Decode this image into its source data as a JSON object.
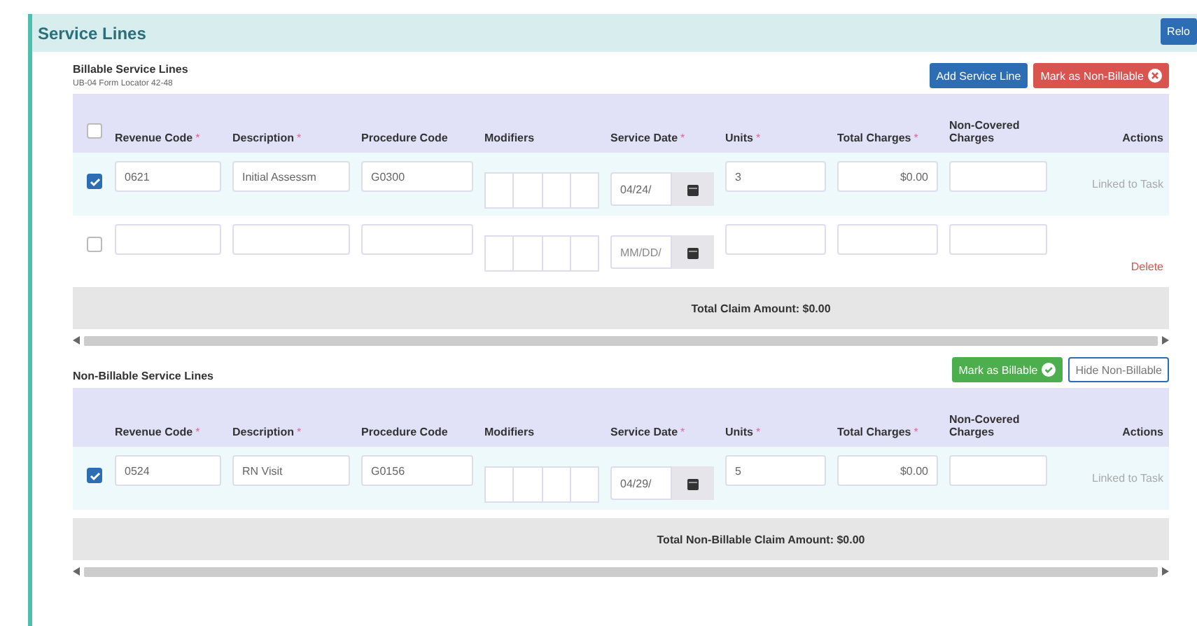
{
  "section": {
    "title": "Service Lines",
    "header_button": "Relo"
  },
  "billable": {
    "title": "Billable Service Lines",
    "subtitle": "UB-04 Form Locator 42-48",
    "buttons": [
      {
        "label": "Add Service Line",
        "kind": "primary"
      },
      {
        "label": "Mark as Non-Billable",
        "kind": "danger"
      }
    ],
    "select_all": {
      "checked": false
    },
    "columns": [
      {
        "label": "Revenue Code",
        "mark": "*"
      },
      {
        "label": "Description",
        "mark": "*"
      },
      {
        "label": "Procedure Code"
      },
      {
        "label": "Modifiers"
      },
      {
        "label": "Service Date",
        "mark": "*"
      },
      {
        "label": "Units",
        "mark": "*"
      },
      {
        "label": "Total Charges",
        "mark": "*"
      },
      {
        "label": "Non-Covered Charges"
      },
      {
        "label": "Actions"
      }
    ],
    "rows": [
      {
        "checked": true,
        "revenue_code": "0621",
        "description": "Initial Assessm",
        "procedure_code": "G0300",
        "service_date": {
          "value": "04/24/"
        },
        "units": "3",
        "total_charges": "$0.00",
        "action": {
          "kind": "note",
          "label": "Linked to Task"
        }
      },
      {
        "checked": false,
        "service_date": {
          "placeholder": "MM/DD/"
        },
        "action": {
          "kind": "delete",
          "label": "Delete"
        }
      }
    ],
    "total": "Total Claim Amount: $0.00"
  },
  "non_billable": {
    "title": "Non-Billable Service Lines",
    "buttons": [
      {
        "label": "Mark as Billable",
        "kind": "success"
      },
      {
        "label": "Hide Non-Billable",
        "kind": "outline"
      }
    ],
    "columns": [
      {
        "label": "Revenue Code",
        "mark": "*"
      },
      {
        "label": "Description",
        "mark": "*"
      },
      {
        "label": "Procedure Code"
      },
      {
        "label": "Modifiers"
      },
      {
        "label": "Service Date",
        "mark": "*"
      },
      {
        "label": "Units",
        "mark": "*"
      },
      {
        "label": "Total Charges",
        "mark": "*"
      },
      {
        "label": "Non-Covered Charges"
      },
      {
        "label": "Actions"
      }
    ],
    "rows": [
      {
        "checked": true,
        "revenue_code": "0524",
        "description": "RN Visit",
        "procedure_code": "G0156",
        "service_date": {
          "value": "04/29/"
        },
        "units": "5",
        "total_charges": "$0.00",
        "action": {
          "kind": "note",
          "label": "Linked to Task"
        }
      }
    ],
    "total": "Total Non-Billable Claim Amount: $0.00"
  }
}
